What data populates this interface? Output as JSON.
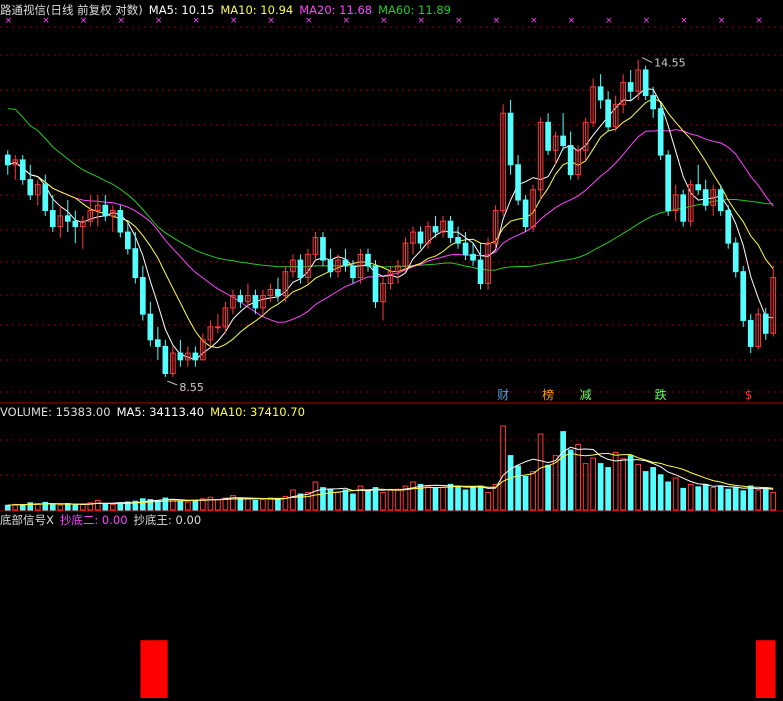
{
  "colors": {
    "background": "#000000",
    "up": "#ff3a3a",
    "down": "#54ffff",
    "ma5": "#ffffff",
    "ma10": "#ffff44",
    "ma20": "#ff44ff",
    "ma60": "#22cc22",
    "grid": "#8b0000",
    "text_white": "#dddddd",
    "signal": "#ff0000"
  },
  "price_panel": {
    "title": "路通视信(日线 前复权 对数)",
    "ma5_label": "MA5: 10.15",
    "ma10_label": "MA10: 10.94",
    "ma20_label": "MA20: 11.68",
    "ma60_label": "MA60: 11.89",
    "high_marker": "14.55",
    "low_marker": "8.55",
    "annotations": [
      "财",
      "榜",
      "减",
      "跌",
      "$"
    ]
  },
  "volume_panel": {
    "volume_label": "VOLUME: 15383.00",
    "ma5_label": "MA5: 34113.40",
    "ma10_label": "MA10: 37410.70"
  },
  "signal_panel": {
    "title": "底部信号X",
    "label1": "抄底二: 0.00",
    "label2": "抄底王: 0.00"
  },
  "chart_data": {
    "type": "candlestick",
    "log_scale": true,
    "ylim": [
      8.2,
      15.6
    ],
    "candles": [
      {
        "o": 12.4,
        "h": 12.5,
        "l": 12.0,
        "c": 12.2
      },
      {
        "o": 12.2,
        "h": 12.4,
        "l": 11.9,
        "c": 12.3
      },
      {
        "o": 12.3,
        "h": 12.4,
        "l": 11.8,
        "c": 11.9
      },
      {
        "o": 11.9,
        "h": 12.2,
        "l": 11.5,
        "c": 11.6
      },
      {
        "o": 11.6,
        "h": 11.9,
        "l": 11.4,
        "c": 11.8
      },
      {
        "o": 11.8,
        "h": 12.0,
        "l": 11.2,
        "c": 11.3
      },
      {
        "o": 11.3,
        "h": 11.6,
        "l": 10.9,
        "c": 11.0
      },
      {
        "o": 11.0,
        "h": 11.4,
        "l": 10.8,
        "c": 11.2
      },
      {
        "o": 11.2,
        "h": 11.5,
        "l": 10.9,
        "c": 11.1
      },
      {
        "o": 11.1,
        "h": 11.3,
        "l": 10.7,
        "c": 11.0
      },
      {
        "o": 11.0,
        "h": 11.2,
        "l": 10.6,
        "c": 11.1
      },
      {
        "o": 11.1,
        "h": 11.6,
        "l": 11.0,
        "c": 11.3
      },
      {
        "o": 11.3,
        "h": 11.6,
        "l": 11.0,
        "c": 11.4
      },
      {
        "o": 11.4,
        "h": 11.6,
        "l": 11.1,
        "c": 11.2
      },
      {
        "o": 11.2,
        "h": 11.4,
        "l": 10.9,
        "c": 11.3
      },
      {
        "o": 11.3,
        "h": 11.4,
        "l": 10.8,
        "c": 10.9
      },
      {
        "o": 10.9,
        "h": 11.1,
        "l": 10.5,
        "c": 10.6
      },
      {
        "o": 10.6,
        "h": 10.9,
        "l": 10.0,
        "c": 10.1
      },
      {
        "o": 10.1,
        "h": 10.3,
        "l": 9.4,
        "c": 9.5
      },
      {
        "o": 9.5,
        "h": 9.7,
        "l": 9.0,
        "c": 9.1
      },
      {
        "o": 9.1,
        "h": 9.3,
        "l": 8.8,
        "c": 9.0
      },
      {
        "o": 9.0,
        "h": 9.1,
        "l": 8.55,
        "c": 8.6
      },
      {
        "o": 8.6,
        "h": 9.0,
        "l": 8.55,
        "c": 8.9
      },
      {
        "o": 8.9,
        "h": 9.1,
        "l": 8.7,
        "c": 8.8
      },
      {
        "o": 8.8,
        "h": 9.0,
        "l": 8.7,
        "c": 8.9
      },
      {
        "o": 8.9,
        "h": 9.0,
        "l": 8.7,
        "c": 8.8
      },
      {
        "o": 8.8,
        "h": 9.2,
        "l": 8.8,
        "c": 9.1
      },
      {
        "o": 9.1,
        "h": 9.4,
        "l": 9.0,
        "c": 9.3
      },
      {
        "o": 9.3,
        "h": 9.5,
        "l": 9.2,
        "c": 9.3
      },
      {
        "o": 9.3,
        "h": 9.7,
        "l": 9.2,
        "c": 9.6
      },
      {
        "o": 9.6,
        "h": 9.9,
        "l": 9.5,
        "c": 9.8
      },
      {
        "o": 9.8,
        "h": 9.9,
        "l": 9.6,
        "c": 9.7
      },
      {
        "o": 9.7,
        "h": 10.0,
        "l": 9.6,
        "c": 9.8
      },
      {
        "o": 9.8,
        "h": 9.9,
        "l": 9.5,
        "c": 9.6
      },
      {
        "o": 9.6,
        "h": 9.9,
        "l": 9.5,
        "c": 9.8
      },
      {
        "o": 9.8,
        "h": 10.0,
        "l": 9.7,
        "c": 9.9
      },
      {
        "o": 9.9,
        "h": 10.1,
        "l": 9.7,
        "c": 9.8
      },
      {
        "o": 9.8,
        "h": 10.3,
        "l": 9.7,
        "c": 10.2
      },
      {
        "o": 10.2,
        "h": 10.5,
        "l": 10.1,
        "c": 10.4
      },
      {
        "o": 10.4,
        "h": 10.5,
        "l": 10.0,
        "c": 10.1
      },
      {
        "o": 10.1,
        "h": 10.6,
        "l": 10.0,
        "c": 10.5
      },
      {
        "o": 10.5,
        "h": 10.9,
        "l": 10.4,
        "c": 10.8
      },
      {
        "o": 10.8,
        "h": 10.9,
        "l": 10.3,
        "c": 10.4
      },
      {
        "o": 10.4,
        "h": 10.6,
        "l": 10.1,
        "c": 10.2
      },
      {
        "o": 10.2,
        "h": 10.5,
        "l": 10.1,
        "c": 10.4
      },
      {
        "o": 10.4,
        "h": 10.6,
        "l": 10.2,
        "c": 10.3
      },
      {
        "o": 10.3,
        "h": 10.4,
        "l": 10.0,
        "c": 10.1
      },
      {
        "o": 10.1,
        "h": 10.6,
        "l": 10.0,
        "c": 10.5
      },
      {
        "o": 10.5,
        "h": 10.6,
        "l": 10.2,
        "c": 10.3
      },
      {
        "o": 10.3,
        "h": 10.4,
        "l": 9.6,
        "c": 9.7
      },
      {
        "o": 9.7,
        "h": 10.1,
        "l": 9.4,
        "c": 10.0
      },
      {
        "o": 10.0,
        "h": 10.3,
        "l": 9.9,
        "c": 10.2
      },
      {
        "o": 10.2,
        "h": 10.4,
        "l": 10.0,
        "c": 10.3
      },
      {
        "o": 10.3,
        "h": 10.8,
        "l": 10.2,
        "c": 10.7
      },
      {
        "o": 10.7,
        "h": 11.0,
        "l": 10.5,
        "c": 10.9
      },
      {
        "o": 10.9,
        "h": 11.0,
        "l": 10.6,
        "c": 10.7
      },
      {
        "o": 10.7,
        "h": 11.1,
        "l": 10.6,
        "c": 11.0
      },
      {
        "o": 11.0,
        "h": 11.2,
        "l": 10.8,
        "c": 10.9
      },
      {
        "o": 10.9,
        "h": 11.2,
        "l": 10.8,
        "c": 11.1
      },
      {
        "o": 11.1,
        "h": 11.2,
        "l": 10.7,
        "c": 10.8
      },
      {
        "o": 10.8,
        "h": 11.0,
        "l": 10.6,
        "c": 10.7
      },
      {
        "o": 10.7,
        "h": 10.9,
        "l": 10.4,
        "c": 10.5
      },
      {
        "o": 10.5,
        "h": 10.7,
        "l": 10.3,
        "c": 10.4
      },
      {
        "o": 10.4,
        "h": 10.7,
        "l": 9.9,
        "c": 10.0
      },
      {
        "o": 10.0,
        "h": 10.8,
        "l": 9.9,
        "c": 10.7
      },
      {
        "o": 10.7,
        "h": 11.4,
        "l": 10.6,
        "c": 11.3
      },
      {
        "o": 11.3,
        "h": 13.5,
        "l": 11.2,
        "c": 13.3
      },
      {
        "o": 13.3,
        "h": 13.6,
        "l": 12.0,
        "c": 12.2
      },
      {
        "o": 12.2,
        "h": 12.4,
        "l": 11.4,
        "c": 11.5
      },
      {
        "o": 11.5,
        "h": 11.6,
        "l": 10.9,
        "c": 11.0
      },
      {
        "o": 11.0,
        "h": 11.8,
        "l": 10.9,
        "c": 11.7
      },
      {
        "o": 11.7,
        "h": 13.2,
        "l": 11.5,
        "c": 13.1
      },
      {
        "o": 13.1,
        "h": 13.3,
        "l": 12.4,
        "c": 12.5
      },
      {
        "o": 12.5,
        "h": 12.9,
        "l": 12.2,
        "c": 12.8
      },
      {
        "o": 12.8,
        "h": 13.3,
        "l": 12.5,
        "c": 12.6
      },
      {
        "o": 12.6,
        "h": 12.9,
        "l": 11.9,
        "c": 12.0
      },
      {
        "o": 12.0,
        "h": 12.6,
        "l": 11.9,
        "c": 12.5
      },
      {
        "o": 12.5,
        "h": 13.2,
        "l": 12.3,
        "c": 13.1
      },
      {
        "o": 13.1,
        "h": 14.1,
        "l": 13.0,
        "c": 13.9
      },
      {
        "o": 13.9,
        "h": 14.2,
        "l": 13.4,
        "c": 13.6
      },
      {
        "o": 13.6,
        "h": 13.8,
        "l": 12.9,
        "c": 13.0
      },
      {
        "o": 13.0,
        "h": 13.7,
        "l": 12.9,
        "c": 13.5
      },
      {
        "o": 13.5,
        "h": 14.2,
        "l": 13.3,
        "c": 14.0
      },
      {
        "o": 14.0,
        "h": 14.3,
        "l": 13.6,
        "c": 13.8
      },
      {
        "o": 13.8,
        "h": 14.55,
        "l": 13.6,
        "c": 14.3
      },
      {
        "o": 14.3,
        "h": 14.4,
        "l": 13.6,
        "c": 13.7
      },
      {
        "o": 13.7,
        "h": 13.9,
        "l": 13.2,
        "c": 13.4
      },
      {
        "o": 13.4,
        "h": 13.5,
        "l": 12.3,
        "c": 12.4
      },
      {
        "o": 12.4,
        "h": 12.5,
        "l": 11.2,
        "c": 11.3
      },
      {
        "o": 11.3,
        "h": 11.8,
        "l": 11.1,
        "c": 11.6
      },
      {
        "o": 11.6,
        "h": 11.7,
        "l": 11.0,
        "c": 11.1
      },
      {
        "o": 11.1,
        "h": 11.9,
        "l": 11.0,
        "c": 11.8
      },
      {
        "o": 11.8,
        "h": 12.2,
        "l": 11.6,
        "c": 11.7
      },
      {
        "o": 11.7,
        "h": 11.9,
        "l": 11.3,
        "c": 11.4
      },
      {
        "o": 11.4,
        "h": 11.8,
        "l": 11.2,
        "c": 11.7
      },
      {
        "o": 11.7,
        "h": 11.8,
        "l": 11.2,
        "c": 11.3
      },
      {
        "o": 11.3,
        "h": 11.4,
        "l": 10.6,
        "c": 10.7
      },
      {
        "o": 10.7,
        "h": 10.8,
        "l": 10.1,
        "c": 10.2
      },
      {
        "o": 10.2,
        "h": 10.3,
        "l": 9.3,
        "c": 9.4
      },
      {
        "o": 9.4,
        "h": 9.5,
        "l": 8.9,
        "c": 9.0
      },
      {
        "o": 9.0,
        "h": 9.6,
        "l": 8.95,
        "c": 9.5
      },
      {
        "o": 9.5,
        "h": 9.6,
        "l": 9.1,
        "c": 9.2
      },
      {
        "o": 9.2,
        "h": 10.3,
        "l": 9.15,
        "c": 10.1
      }
    ],
    "volume": [
      600,
      700,
      650,
      900,
      800,
      950,
      700,
      600,
      800,
      650,
      700,
      900,
      1200,
      800,
      700,
      900,
      1000,
      1100,
      1400,
      1300,
      1200,
      1500,
      1300,
      1100,
      1000,
      1200,
      1400,
      1600,
      1300,
      1500,
      1800,
      1500,
      1400,
      1200,
      1300,
      1500,
      1400,
      1700,
      2500,
      2000,
      2200,
      3500,
      2800,
      2600,
      2200,
      2500,
      2000,
      3000,
      2400,
      2800,
      2200,
      2500,
      2600,
      3000,
      3500,
      3200,
      3000,
      2800,
      2800,
      3200,
      3000,
      2500,
      2800,
      3000,
      2200,
      3200,
      10500,
      6800,
      5500,
      4200,
      4800,
      9500,
      5600,
      6800,
      9800,
      7500,
      8200,
      5800,
      6500,
      5800,
      5300,
      7200,
      6400,
      6800,
      5700,
      4800,
      5300,
      4400,
      3500,
      4000,
      2700,
      3200,
      2900,
      3200,
      2800,
      3000,
      2600,
      2800,
      2400,
      3000,
      2500,
      2800,
      2200
    ],
    "vol_ylim": [
      0,
      11500
    ],
    "signal_bars": [
      {
        "from_index": 18,
        "to_index": 21,
        "value": 1
      },
      {
        "from_index": 100,
        "to_index": 102,
        "value": 1
      }
    ]
  }
}
